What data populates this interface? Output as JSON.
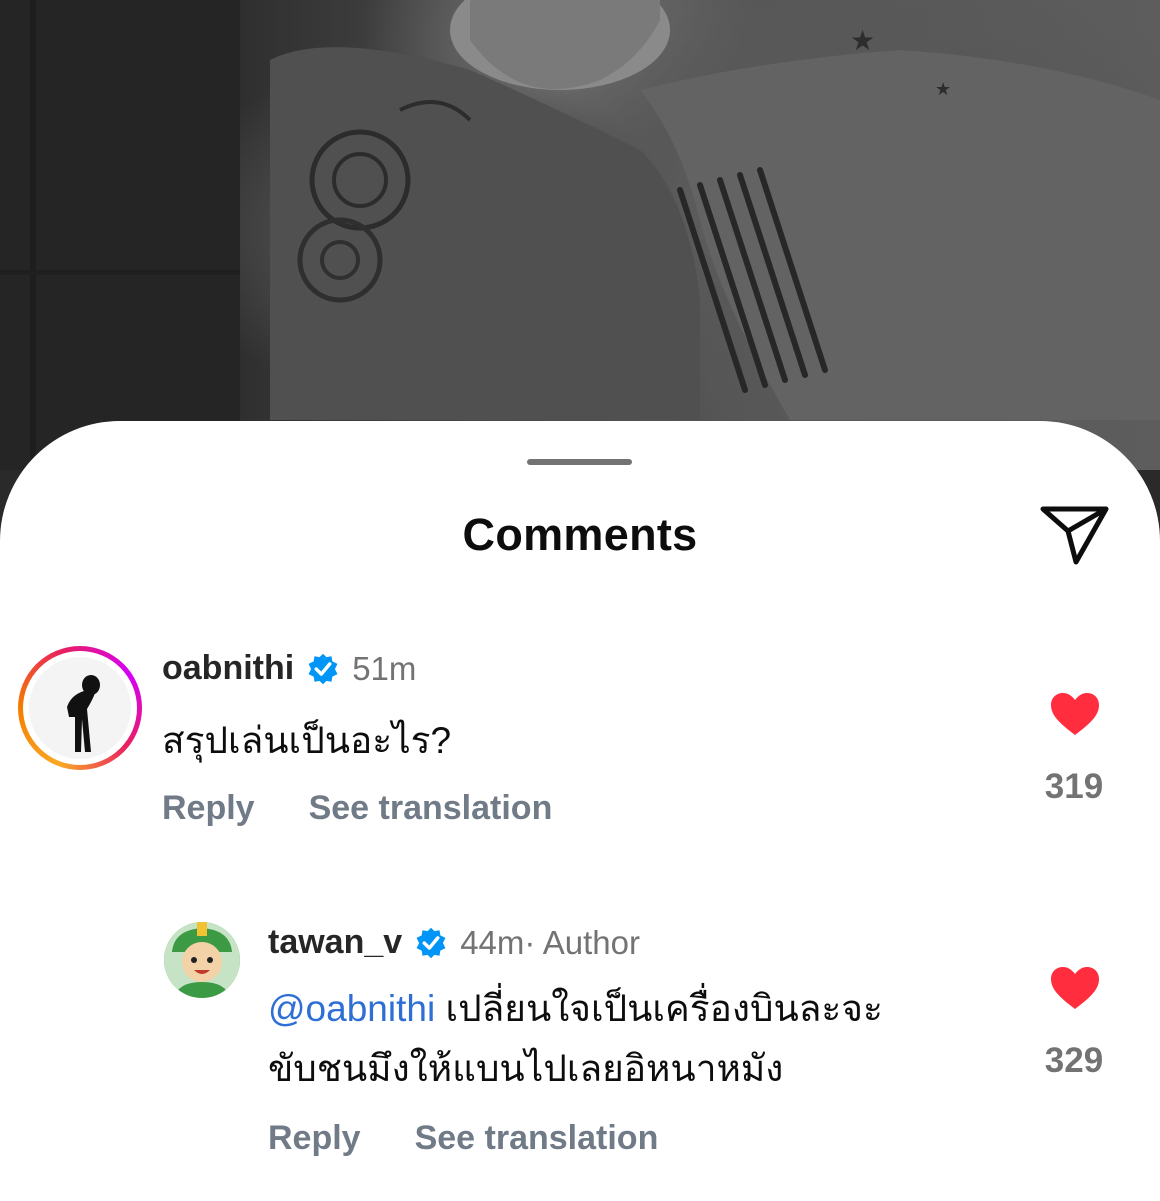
{
  "sheet": {
    "title": "Comments"
  },
  "comments": [
    {
      "username": "oabnithi",
      "verified": true,
      "time": "51m",
      "text": "สรุปเล่นเป็นอะไร?",
      "reply_label": "Reply",
      "translate_label": "See translation",
      "like_count": "319",
      "liked": true,
      "story_ring": true
    },
    {
      "username": "tawan_v",
      "verified": true,
      "time": "44m",
      "author_tag": " · Author",
      "mention": "@oabnithi",
      "text_line1": " เปลี่ยนใจเป็นเครื่องบินละจะ",
      "text_line2": "ขับชนมึงให้แบนไปเลยอิหนาหมัง",
      "reply_label": "Reply",
      "translate_label": "See translation",
      "like_count": "329",
      "liked": true,
      "story_ring": false
    }
  ],
  "colors": {
    "heart": "#ff2d3d",
    "verified": "#0095f6",
    "mention": "#2e6fd6",
    "secondary_text": "#737373"
  },
  "icons": [
    "share-icon",
    "verified-badge-icon",
    "heart-icon"
  ]
}
